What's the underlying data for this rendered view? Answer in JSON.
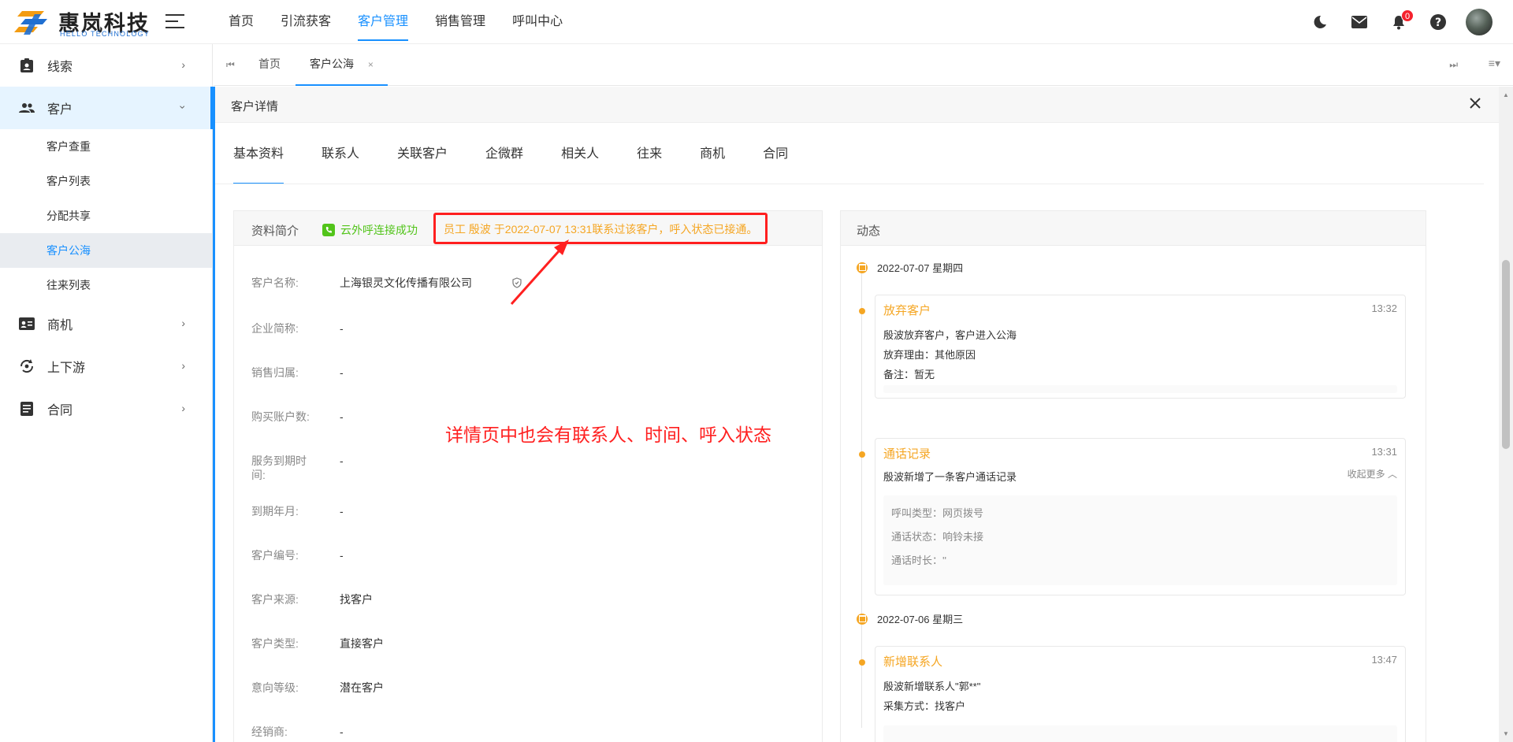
{
  "brand": {
    "name_cn": "惠岚科技",
    "name_en": "HELLO TECHNOLOGY",
    "accent": "#1890ff"
  },
  "topnav": [
    {
      "label": "首页"
    },
    {
      "label": "引流获客"
    },
    {
      "label": "客户管理",
      "active": true
    },
    {
      "label": "销售管理"
    },
    {
      "label": "呼叫中心"
    }
  ],
  "header_icons": {
    "notifications_count": "0"
  },
  "sidebar": {
    "items": [
      {
        "label": "线索",
        "icon": "clue-icon"
      },
      {
        "label": "客户",
        "icon": "people-icon",
        "open": true,
        "children": [
          {
            "label": "客户查重"
          },
          {
            "label": "客户列表"
          },
          {
            "label": "分配共享"
          },
          {
            "label": "客户公海",
            "active": true
          },
          {
            "label": "往来列表"
          }
        ]
      },
      {
        "label": "商机",
        "icon": "card-icon"
      },
      {
        "label": "上下游",
        "icon": "flow-icon"
      },
      {
        "label": "合同",
        "icon": "document-icon"
      }
    ]
  },
  "page_tabs": [
    {
      "label": "首页"
    },
    {
      "label": "客户公海",
      "active": true,
      "close": "×"
    }
  ],
  "drawer": {
    "title": "客户详情",
    "tabs": [
      "基本资料",
      "联系人",
      "关联客户",
      "企微群",
      "相关人",
      "往来",
      "商机",
      "合同"
    ]
  },
  "profile": {
    "title": "资料简介",
    "call_status": "云外呼连接成功",
    "call_note": "员工 殷波 于2022-07-07 13:31联系过该客户，呼入状态已接通。",
    "annotation": "详情页中也会有联系人、时间、呼入状态",
    "annotation_color": "#ff2020",
    "fields": [
      {
        "label": "客户名称:",
        "value": "上海银灵文化传播有限公司"
      },
      {
        "label": "企业简称:",
        "value": "-"
      },
      {
        "label": "销售归属:",
        "value": "-"
      },
      {
        "label": "购买账户数:",
        "value": "-"
      },
      {
        "label": "服务到期时间:",
        "value": "-"
      },
      {
        "label": "到期年月:",
        "value": "-"
      },
      {
        "label": "客户编号:",
        "value": "-"
      },
      {
        "label": "客户来源:",
        "value": "找客户"
      },
      {
        "label": "客户类型:",
        "value": "直接客户"
      },
      {
        "label": "意向等级:",
        "value": "潜在客户"
      },
      {
        "label": "经销商:",
        "value": "-"
      }
    ]
  },
  "activity": {
    "title": "动态",
    "groups": [
      {
        "date": "2022-07-07 星期四",
        "events": [
          {
            "title": "放弃客户",
            "time": "13:32",
            "lines": [
              "殷波放弃客户，客户进入公海",
              "放弃理由：其他原因",
              "备注：暂无"
            ]
          },
          {
            "title": "通话记录",
            "time": "13:31",
            "lines": [
              "殷波新增了一条客户通话记录"
            ],
            "collapse": "收起更多",
            "details": [
              "呼叫类型：网页拨号",
              "通话状态：响铃未接",
              "通话时长：''"
            ]
          }
        ]
      },
      {
        "date": "2022-07-06 星期三",
        "events": [
          {
            "title": "新增联系人",
            "time": "13:47",
            "lines": [
              "殷波新增联系人\"郭**\"",
              "采集方式：找客户"
            ]
          }
        ]
      }
    ]
  }
}
